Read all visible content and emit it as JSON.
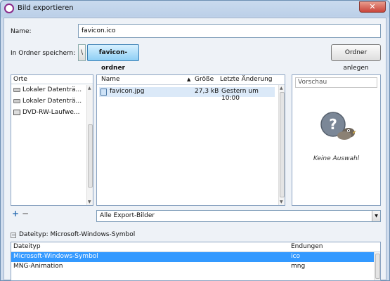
{
  "window": {
    "title": "Bild exportieren",
    "close_label": "✕"
  },
  "name_field": {
    "label": "Name:",
    "value": "favicon.ico"
  },
  "folder": {
    "label": "In Ordner speichern:",
    "back_glyph": "\\",
    "current": "favicon-ordner",
    "new_folder_label": "Ordner anlegen"
  },
  "places": {
    "header": "Orte",
    "items": [
      {
        "label": "Lokaler Datenträ...",
        "icon": "hard-drive-icon"
      },
      {
        "label": "Lokaler Datenträ...",
        "icon": "hard-drive-icon"
      },
      {
        "label": "DVD-RW-Laufwe...",
        "icon": "dvd-drive-icon"
      }
    ]
  },
  "files": {
    "columns": {
      "name": "Name",
      "size": "Größe",
      "modified": "Letzte Änderung"
    },
    "sort_glyph": "▲",
    "rows": [
      {
        "name": "favicon.jpg",
        "size": "27,3 kB",
        "modified": "Gestern um 10:00"
      }
    ]
  },
  "preview": {
    "label": "Vorschau",
    "no_selection": "Keine Auswahl"
  },
  "filter": {
    "value": "Alle Export-Bilder"
  },
  "filetype": {
    "expander_glyph": "−",
    "label": "Dateityp: Microsoft-Windows-Symbol",
    "columns": {
      "type": "Dateityp",
      "extensions": "Endungen"
    },
    "rows": [
      {
        "type": "Microsoft-Windows-Symbol",
        "ext": "ico",
        "selected": true
      },
      {
        "type": "MNG-Animation",
        "ext": "mng",
        "selected": false
      }
    ]
  },
  "colors": {
    "selection": "#3399ff",
    "path_button": "#8ecff5"
  }
}
